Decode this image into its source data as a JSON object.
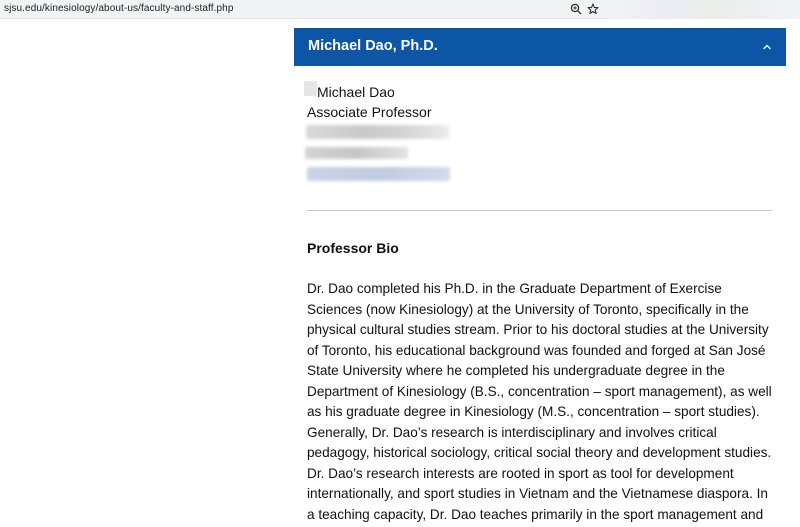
{
  "browser": {
    "url": "sjsu.edu/kinesiology/about-us/faculty-and-staff.php",
    "zoom_icon": "zoom-icon",
    "bookmark_icon": "star-icon"
  },
  "accordion": {
    "title": "Michael Dao, Ph.D.",
    "chevron_icon": "chevron-up-icon",
    "header_color": "#0d56a6"
  },
  "profile": {
    "name": "Michael Dao",
    "title": "Associate Professor"
  },
  "bio": {
    "heading": "Professor Bio",
    "text": "Dr. Dao completed his Ph.D. in the Graduate Department of Exercise Sciences (now Kinesiology) at the University of Toronto, specifically in the physical cultural studies stream. Prior to his doctoral studies at the University of Toronto, his educational background was founded and forged at San José State University where he completed his undergraduate degree in the Department of Kinesiology (B.S., concentration – sport management), as well as his graduate degree in Kinesiology (M.S., concentration – sport studies). Generally, Dr. Dao’s research is interdisciplinary and involves critical pedagogy, historical sociology, critical social theory and development studies. Dr. Dao’s research interests are rooted in sport as tool for development internationally, and sport studies in Vietnam and the Vietnamese diaspora. In a teaching capacity, Dr. Dao teaches primarily in the sport management and"
  }
}
